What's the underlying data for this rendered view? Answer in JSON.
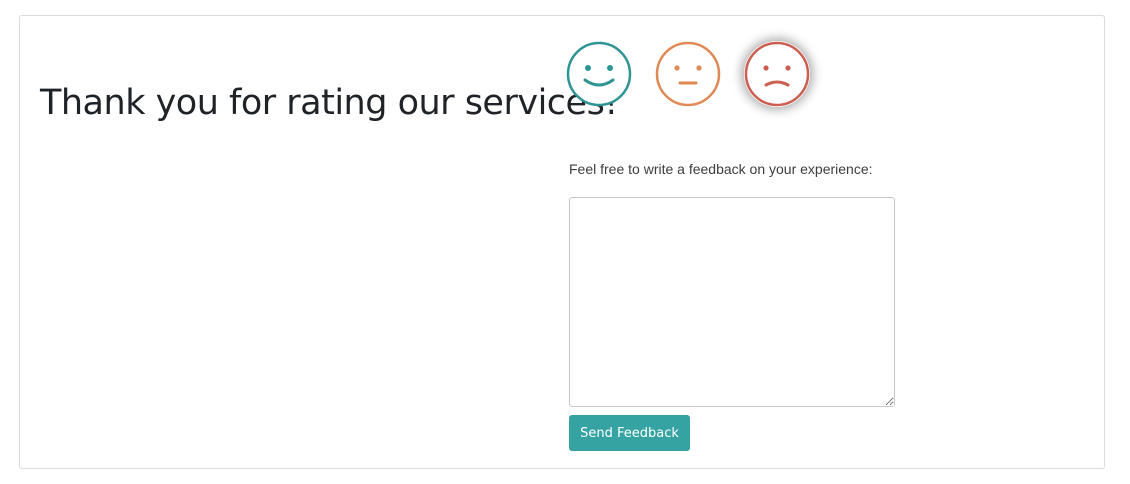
{
  "page": {
    "title": "Thank you for rating our services!"
  },
  "rating": {
    "options": [
      {
        "name": "happy",
        "icon": "happy-face-icon",
        "color": "#2e9494"
      },
      {
        "name": "neutral",
        "icon": "neutral-face-icon",
        "color": "#df8a55"
      },
      {
        "name": "sad",
        "icon": "sad-face-icon",
        "color": "#cc5e52",
        "selected": true
      }
    ]
  },
  "feedback": {
    "prompt": "Feel free to write a feedback on your experience:",
    "value": "",
    "placeholder": ""
  },
  "actions": {
    "send_label": "Send Feedback",
    "send_color": "#36a3a3"
  }
}
